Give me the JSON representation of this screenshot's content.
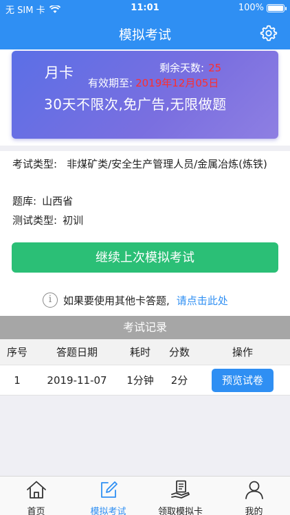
{
  "status_bar": {
    "carrier": "无 SIM 卡",
    "time": "11:01",
    "battery": "100%"
  },
  "nav": {
    "title": "模拟考试"
  },
  "card": {
    "type": "月卡",
    "remaining_label": "剩余天数:",
    "remaining_days": "25",
    "valid_label": "有效期至:",
    "valid_date": "2019年12月05日",
    "description": "30天不限次,免广告,无限做题"
  },
  "info": {
    "exam_type_label": "考试类型:",
    "exam_type_value": "非煤矿类/安全生产管理人员/金属冶炼(炼铁)",
    "bank_label": "题库:",
    "bank_value": "山西省",
    "test_type_label": "测试类型:",
    "test_type_value": "初训"
  },
  "continue_button": "继续上次模拟考试",
  "other_card": {
    "text": "如果要使用其他卡答题,",
    "link": "请点击此处"
  },
  "records": {
    "title": "考试记录",
    "headers": [
      "序号",
      "答题日期",
      "耗时",
      "分数",
      "操作"
    ],
    "rows": [
      {
        "index": "1",
        "date": "2019-11-07",
        "duration": "1分钟",
        "score": "2分",
        "action": "预览试卷"
      }
    ]
  },
  "tabs": [
    {
      "label": "首页",
      "icon": "home-icon"
    },
    {
      "label": "模拟考试",
      "icon": "edit-icon",
      "active": true
    },
    {
      "label": "领取模拟卡",
      "icon": "card-hand-icon"
    },
    {
      "label": "我的",
      "icon": "person-icon"
    }
  ],
  "colors": {
    "primary": "#2f8ff3",
    "success": "#2bbf76",
    "highlight": "#ff2d2d"
  }
}
